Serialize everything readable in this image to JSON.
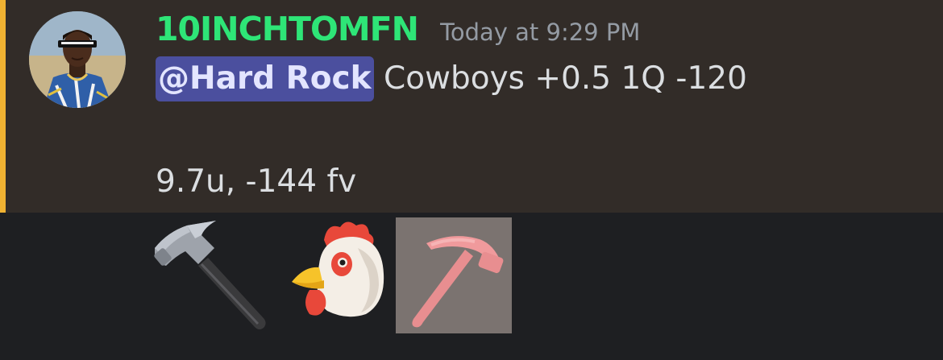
{
  "message": {
    "author": "10INCHTOMFN",
    "timestamp": "Today at 9:29 PM",
    "mention": "@Hard Rock",
    "line1_text": " Cowboys +0.5 1Q -120",
    "line2_text": "9.7u, -144 fv"
  },
  "avatar": {
    "icon": "user-avatar"
  },
  "reactions": [
    {
      "icon": "hammer-icon"
    },
    {
      "icon": "rooster-icon"
    },
    {
      "icon": "pickaxe-icon"
    }
  ],
  "colors": {
    "username": "#2ee577",
    "mention_bg": "#4b4f9e",
    "mention_bar": "#f0b232",
    "message_bg": "#322c28",
    "page_bg": "#1e1f22"
  }
}
